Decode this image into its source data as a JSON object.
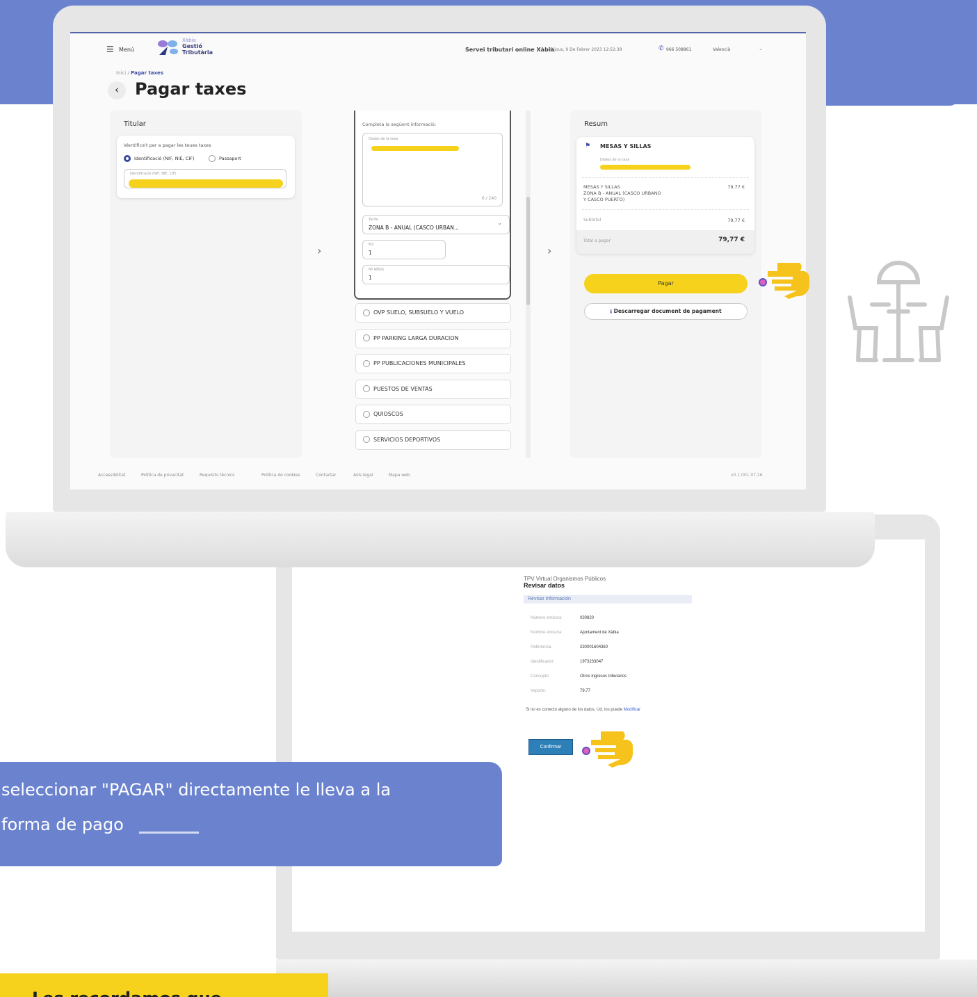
{
  "colors": {
    "accent": "#6b83cf",
    "yellow": "#f6d21d",
    "dark_blue": "#3a4aa0",
    "confirm_blue": "#2d7fb8"
  },
  "header": {
    "menu_label": "Menú",
    "brand_top": "Xàbia",
    "brand_line1": "Gestió",
    "brand_line2": "Tributària",
    "service_title": "Servei tributari online Xàbia",
    "datetime": "Dijous, 9 De Febrer 2023 12:52:39",
    "phone": "966 508861",
    "language": "Valencià"
  },
  "breadcrumb": {
    "home": "Inici",
    "separator": "/",
    "current": "Pagar taxes"
  },
  "page_title": "Pagar taxes",
  "titular": {
    "heading": "Titular",
    "prompt": "Identifica't per a pagar les teues taxes",
    "option_id": "Identificació (NIF, NIE, CIF)",
    "option_passport": "Passaport",
    "field_label": "Identificació (NIF, NIE, CIF)"
  },
  "form": {
    "intro": "Completa la següent informació:",
    "datos_label": "Dades de la taxa",
    "char_count": "6 / 240",
    "tarifa_label": "Tarifa",
    "tarifa_value": "ZONA B - ANUAL (CASCO URBAN...",
    "m2_label": "M2",
    "m2_value": "1",
    "anios_label": "Nº AÑOS",
    "anios_value": "1",
    "options": [
      "OVP SUELO, SUBSUELO Y VUELO",
      "PP PARKING LARGA DURACION",
      "PP PUBLICACIONES MUNICIPALES",
      "PUESTOS DE VENTAS",
      "QUIOSCOS",
      "SERVICIOS DEPORTIVOS"
    ]
  },
  "resum": {
    "heading": "Resum",
    "item_title": "MESAS Y SILLAS",
    "datos_label": "Dades de la taxa",
    "line_name": "MESAS Y SILLAS",
    "line_desc1": "ZONA B - ANUAL (CASCO URBANO",
    "line_desc2": "Y CASCO PUERTO)",
    "line_amount": "79,77 €",
    "subtotal_label": "Subtotal",
    "subtotal_amount": "79,77 €",
    "total_label": "Total a pagar",
    "total_amount": "79,77 €",
    "pay_button": "Pagar",
    "download_button": "Descarregar document de pagament"
  },
  "footer": {
    "links": [
      "Accessibilitat",
      "Política de privacitat",
      "Requisits tècnics",
      "Política de cookies",
      "Contactar",
      "Avís legal",
      "Mapa web"
    ],
    "version": "v0.1.001.07.26"
  },
  "tpv": {
    "subtitle": "TPV Virtual Organismos Públicos",
    "title": "Revisar datos",
    "section": "Revisar información",
    "rows": [
      {
        "label": "Número emisora:",
        "value": "030820"
      },
      {
        "label": "Nombre emisora:",
        "value": "Ajuntament de Xàbia"
      },
      {
        "label": "Referencia:",
        "value": "230001604360"
      },
      {
        "label": "Identificador:",
        "value": "1973233047"
      },
      {
        "label": "Concepto:",
        "value": "Otros ingresos tributarios"
      },
      {
        "label": "Importe:",
        "value": "79.77"
      }
    ],
    "note": "Si no es correcto alguno de los datos, Ud. los puede",
    "note_link": "Modificar",
    "confirm_button": "Confirmar"
  },
  "callout": {
    "line1": "seleccionar \"PAGAR\" directamente le lleva a la",
    "line2": "forma de pago"
  },
  "bottom_note": "Les recordamos que"
}
